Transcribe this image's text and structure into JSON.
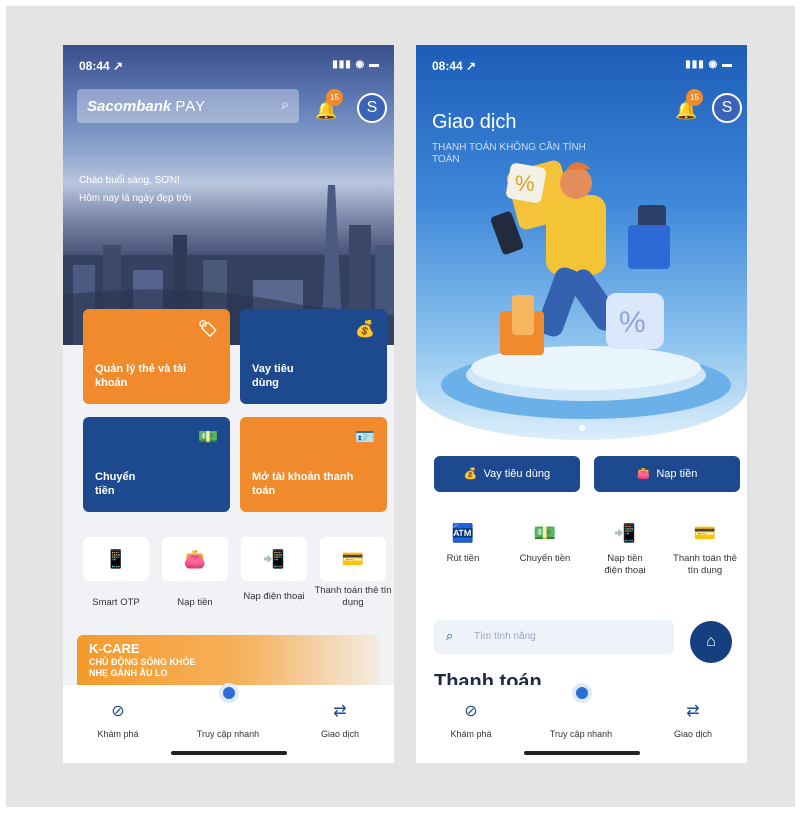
{
  "left": {
    "status_time": "08:44 ↗",
    "brand": "Sacombank",
    "brand_suffix": "PAY",
    "badge": "15",
    "avatar": "S",
    "greeting": "Chào buổi sáng, SƠN!",
    "greeting_sub": "Hôm nay là ngày đẹp trời",
    "tiles": [
      {
        "label": "Quản lý thẻ và tài khoản"
      },
      {
        "label": "Vay tiêu dùng"
      },
      {
        "label": "Chuyển tiền"
      },
      {
        "label": "Mở tài khoản thanh toán"
      }
    ],
    "quick": [
      {
        "label": "Smart OTP"
      },
      {
        "label": "Nạp tiền"
      },
      {
        "label": "Nạp điện thoại"
      },
      {
        "label": "Thanh toán thẻ tín dụng"
      }
    ],
    "banner": {
      "title": "K-CARE",
      "line1": "CHỦ ĐỘNG SỐNG KHỎE",
      "line2": "NHẸ GÁNH ÂU LO"
    },
    "nav": [
      "Khám phá",
      "Truy cập nhanh",
      "Giao dịch"
    ]
  },
  "right": {
    "status_time": "08:44 ↗",
    "badge": "15",
    "avatar": "S",
    "title": "Giao dịch",
    "subtitle": "THANH TOÁN KHÔNG CẦN TÍNH TOÁN",
    "buttons": [
      "Vay tiêu dùng",
      "Nạp tiền"
    ],
    "features": [
      "Rút tiền",
      "Chuyển tiền",
      "Nạp tiền điện thoại",
      "Thanh toán thẻ tín dụng"
    ],
    "search_placeholder": "Tìm tính năng",
    "section_title": "Thanh toán",
    "nav": [
      "Khám phá",
      "Truy cập nhanh",
      "Giao dịch"
    ]
  },
  "colors": {
    "brand_blue": "#1d4a8f",
    "brand_orange": "#f08a2c",
    "accent_blue": "#2b6fd6"
  }
}
